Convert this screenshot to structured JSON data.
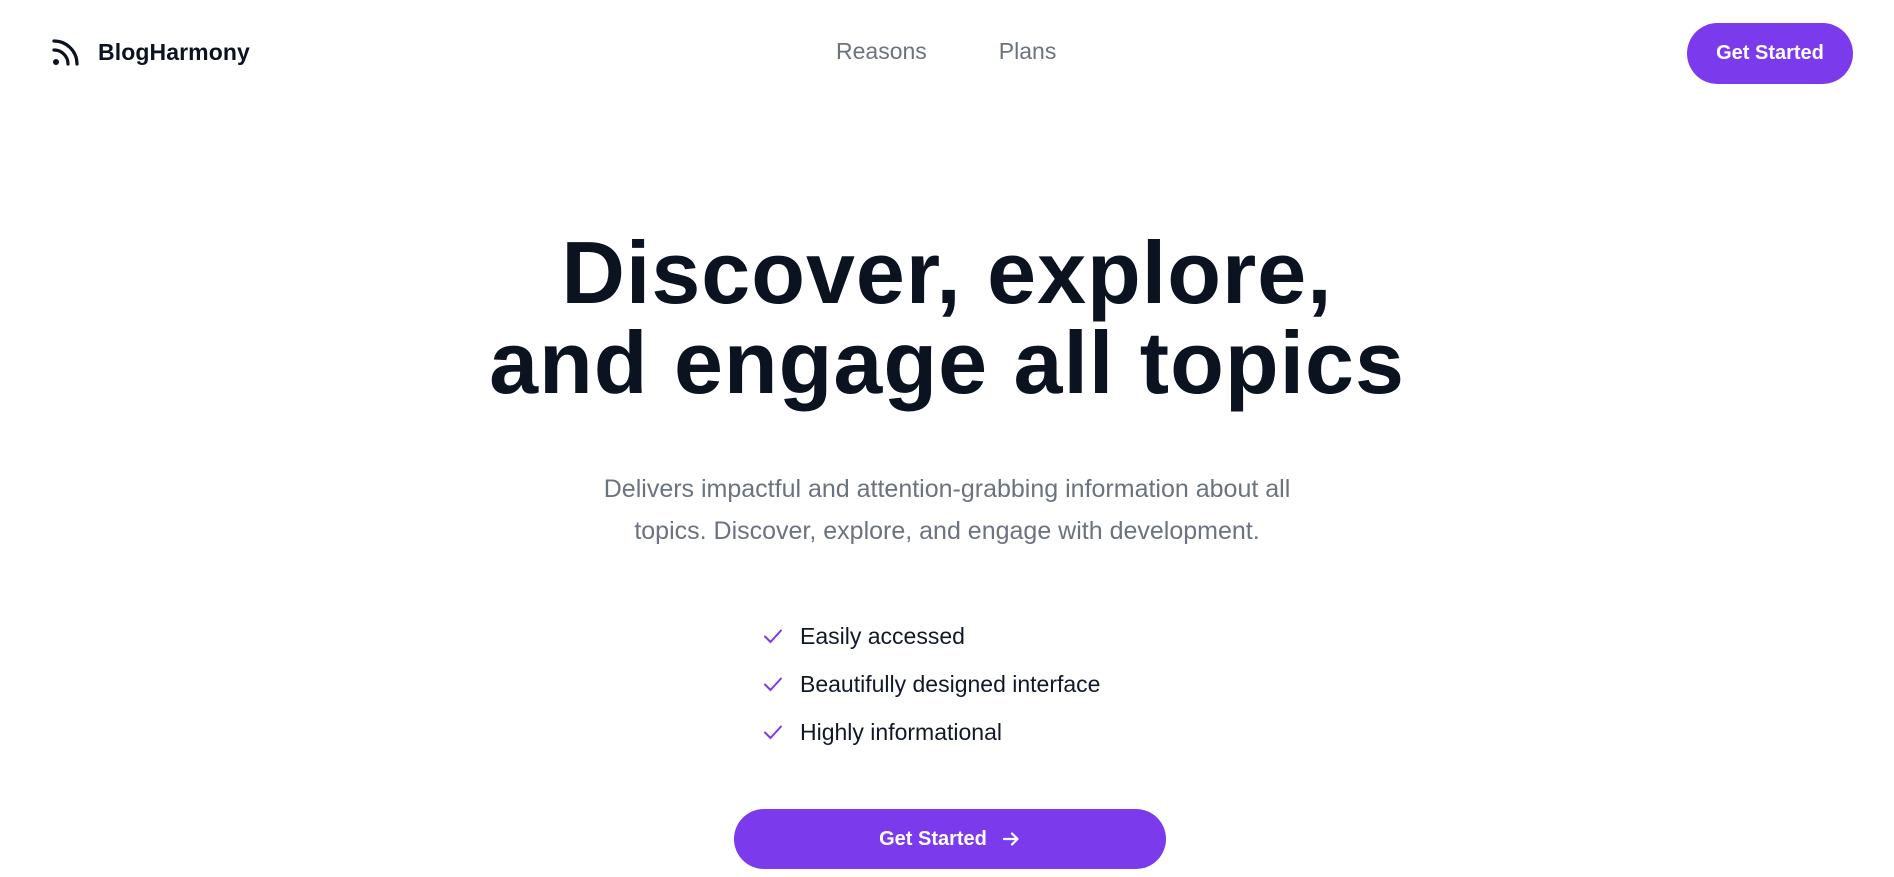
{
  "header": {
    "brand": {
      "icon": "rss-icon",
      "name": "BlogHarmony"
    },
    "nav": [
      {
        "label": "Reasons"
      },
      {
        "label": "Plans"
      }
    ],
    "cta_label": "Get Started"
  },
  "hero": {
    "title_lines": [
      "Discover, explore,",
      "and engage all topics"
    ],
    "subtitle_lines": [
      "Delivers impactful and attention-grabbing information about all",
      "topics. Discover, explore, and engage with development."
    ],
    "features": [
      {
        "icon": "check-icon",
        "label": "Easily accessed"
      },
      {
        "icon": "check-icon",
        "label": "Beautifully designed interface"
      },
      {
        "icon": "check-icon",
        "label": "Highly informational"
      }
    ],
    "cta_label": "Get Started",
    "cta_icon": "arrow-right-icon"
  },
  "colors": {
    "accent": "#7c3aed",
    "heading": "#0b1220",
    "muted": "#6b7280",
    "background": "#ffffff"
  }
}
